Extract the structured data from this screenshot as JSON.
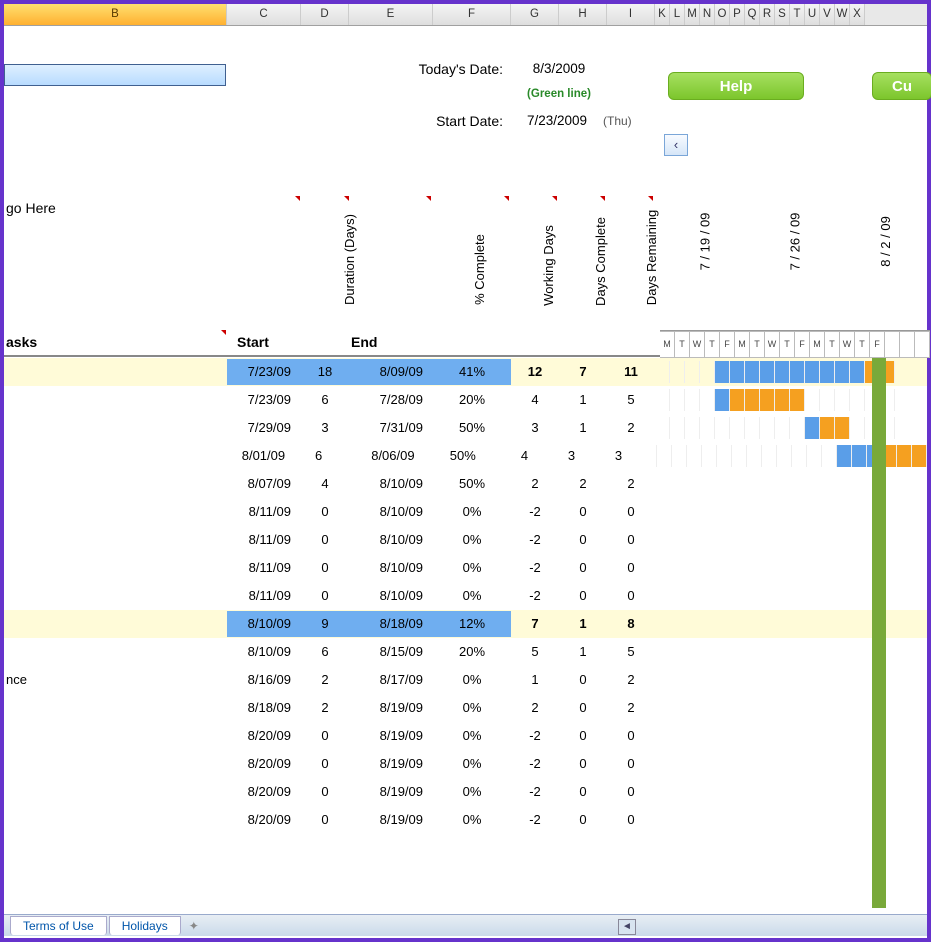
{
  "columns": [
    "B",
    "C",
    "D",
    "E",
    "F",
    "G",
    "H",
    "I",
    "K",
    "L",
    "M",
    "N",
    "O",
    "P",
    "Q",
    "R",
    "S",
    "T",
    "U",
    "V",
    "W",
    "X"
  ],
  "selected_column": "B",
  "labels": {
    "todays_date": "Today's Date:",
    "start_date": "Start Date:",
    "green_line": "(Green line)",
    "logo": "go Here",
    "tasks": "asks",
    "start": "Start",
    "duration": "Duration (Days)",
    "end": "End",
    "pct_complete": "% Complete",
    "working_days": "Working Days",
    "days_complete": "Days Complete",
    "days_remaining": "Days Remaining",
    "nce": "nce"
  },
  "values": {
    "todays_date": "8/3/2009",
    "start_date": "7/23/2009",
    "start_day_abbrev": "(Thu)"
  },
  "buttons": {
    "help": "Help",
    "cu": "Cu",
    "scroll_left": "‹"
  },
  "gantt_weeks": [
    "7 / 19 / 09",
    "7 / 26 / 09",
    "8 / 2 / 09"
  ],
  "gantt_day_letters": [
    "M",
    "T",
    "W",
    "T",
    "F",
    "M",
    "T",
    "W",
    "T",
    "F",
    "M",
    "T",
    "W",
    "T",
    "F"
  ],
  "tabs": [
    "Terms of Use",
    "Holidays"
  ],
  "rows": [
    {
      "sum": true,
      "start": "7/23/09",
      "dur": "18",
      "end": "8/09/09",
      "pct": "41%",
      "wd": "12",
      "dc": "7",
      "dr": "11",
      "gantt": [
        null,
        null,
        null,
        null,
        "b",
        "b",
        "b",
        "b",
        "b",
        "b",
        "b",
        "b",
        "b",
        "b",
        "o",
        "o"
      ]
    },
    {
      "start": "7/23/09",
      "dur": "6",
      "end": "7/28/09",
      "pct": "20%",
      "wd": "4",
      "dc": "1",
      "dr": "5",
      "gantt": [
        null,
        null,
        null,
        null,
        "b",
        "o",
        "o",
        "o",
        "o",
        "o",
        null,
        null,
        null,
        null,
        null,
        null
      ]
    },
    {
      "start": "7/29/09",
      "dur": "3",
      "end": "7/31/09",
      "pct": "50%",
      "wd": "3",
      "dc": "1",
      "dr": "2",
      "gantt": [
        null,
        null,
        null,
        null,
        null,
        null,
        null,
        null,
        null,
        null,
        "b",
        "o",
        "o",
        null,
        null,
        null
      ]
    },
    {
      "start": "8/01/09",
      "dur": "6",
      "end": "8/06/09",
      "pct": "50%",
      "wd": "4",
      "dc": "3",
      "dr": "3",
      "gantt": [
        null,
        null,
        null,
        null,
        null,
        null,
        null,
        null,
        null,
        null,
        null,
        null,
        null,
        "b",
        "b",
        "b",
        "o",
        "o",
        "o"
      ]
    },
    {
      "start": "8/07/09",
      "dur": "4",
      "end": "8/10/09",
      "pct": "50%",
      "wd": "2",
      "dc": "2",
      "dr": "2"
    },
    {
      "start": "8/11/09",
      "dur": "0",
      "end": "8/10/09",
      "pct": "0%",
      "wd": "-2",
      "dc": "0",
      "dr": "0"
    },
    {
      "start": "8/11/09",
      "dur": "0",
      "end": "8/10/09",
      "pct": "0%",
      "wd": "-2",
      "dc": "0",
      "dr": "0"
    },
    {
      "start": "8/11/09",
      "dur": "0",
      "end": "8/10/09",
      "pct": "0%",
      "wd": "-2",
      "dc": "0",
      "dr": "0"
    },
    {
      "start": "8/11/09",
      "dur": "0",
      "end": "8/10/09",
      "pct": "0%",
      "wd": "-2",
      "dc": "0",
      "dr": "0"
    },
    {
      "sum": true,
      "start": "8/10/09",
      "dur": "9",
      "end": "8/18/09",
      "pct": "12%",
      "wd": "7",
      "dc": "1",
      "dr": "8"
    },
    {
      "start": "8/10/09",
      "dur": "6",
      "end": "8/15/09",
      "pct": "20%",
      "wd": "5",
      "dc": "1",
      "dr": "5"
    },
    {
      "label": "nce",
      "start": "8/16/09",
      "dur": "2",
      "end": "8/17/09",
      "pct": "0%",
      "wd": "1",
      "dc": "0",
      "dr": "2"
    },
    {
      "start": "8/18/09",
      "dur": "2",
      "end": "8/19/09",
      "pct": "0%",
      "wd": "2",
      "dc": "0",
      "dr": "2"
    },
    {
      "start": "8/20/09",
      "dur": "0",
      "end": "8/19/09",
      "pct": "0%",
      "wd": "-2",
      "dc": "0",
      "dr": "0"
    },
    {
      "start": "8/20/09",
      "dur": "0",
      "end": "8/19/09",
      "pct": "0%",
      "wd": "-2",
      "dc": "0",
      "dr": "0"
    },
    {
      "start": "8/20/09",
      "dur": "0",
      "end": "8/19/09",
      "pct": "0%",
      "wd": "-2",
      "dc": "0",
      "dr": "0"
    },
    {
      "start": "8/20/09",
      "dur": "0",
      "end": "8/19/09",
      "pct": "0%",
      "wd": "-2",
      "dc": "0",
      "dr": "0"
    }
  ]
}
